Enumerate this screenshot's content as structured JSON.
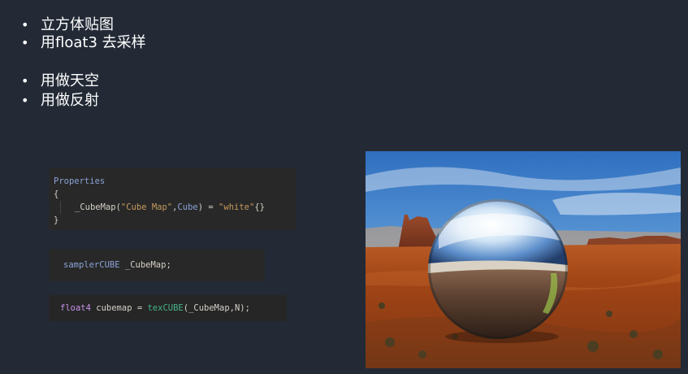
{
  "bullets": [
    {
      "text": "立方体贴图"
    },
    {
      "text": "用float3 去采样"
    },
    {
      "text": "用做天空"
    },
    {
      "text": "用做反射"
    }
  ],
  "bullet_symbol": "•",
  "code1": {
    "line1": "Properties",
    "line2": "{",
    "line3_a": "_CubeMap(",
    "line3_b": "\"Cube Map\"",
    "line3_c": ",",
    "line3_d": "Cube",
    "line3_e": ") = ",
    "line3_f": "\"white\"",
    "line3_g": "{}",
    "line4": "}"
  },
  "code2": {
    "type": "samplerCUBE",
    "rest": " _CubeMap;"
  },
  "code3": {
    "type": "float4",
    "mid": " cubemap = ",
    "fn": "texCUBE",
    "rest": "(_CubeMap,N);"
  },
  "photo": {
    "description_icon": "reflective-sphere-in-desert-image"
  }
}
